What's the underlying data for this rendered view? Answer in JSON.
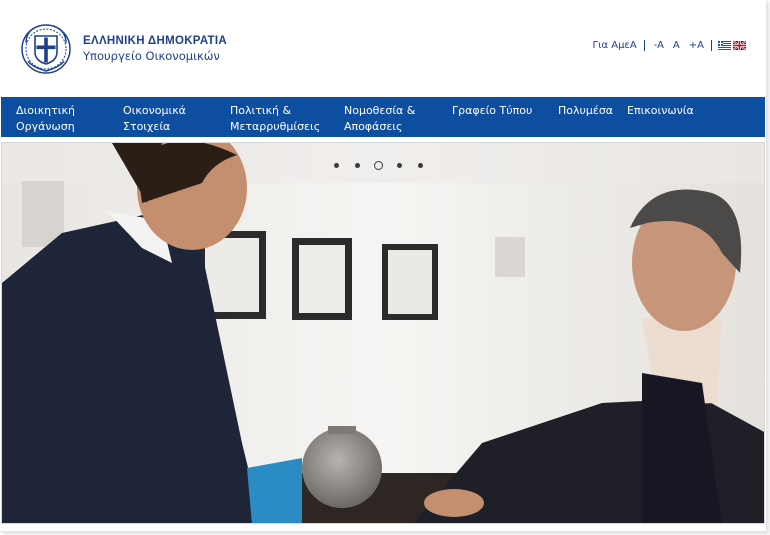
{
  "header": {
    "title": "ΕΛΛΗΝΙΚΗ ΔΗΜΟΚΡΑΤΙΑ",
    "subtitle": "Υπουργείο Οικονομικών",
    "emblem": "greek-coat-of-arms"
  },
  "utility": {
    "accessibility_link": "Για ΑμεΑ",
    "font_decrease": "-A",
    "font_normal": "A",
    "font_increase": "+A",
    "languages": [
      {
        "name": "greek-flag-icon",
        "code": "el"
      },
      {
        "name": "uk-flag-icon",
        "code": "en"
      }
    ]
  },
  "nav": {
    "items": [
      {
        "line1": "Διοικητική",
        "line2": "Οργάνωση"
      },
      {
        "line1": "Οικονομικά",
        "line2": "Στοιχεία"
      },
      {
        "line1": "Πολιτική &",
        "line2": "Μεταρρυθμίσεις"
      },
      {
        "line1": "Νομοθεσία &",
        "line2": "Αποφάσεις"
      },
      {
        "line1": "Γραφείο Τύπου",
        "line2": ""
      },
      {
        "line1": "Πολυμέσα",
        "line2": ""
      },
      {
        "line1": "Επικοινωνία",
        "line2": ""
      }
    ]
  },
  "carousel": {
    "slides": 5,
    "active_slide": 3
  },
  "colors": {
    "brand_blue": "#1d3f8f",
    "nav_blue": "#0d4ea0"
  }
}
